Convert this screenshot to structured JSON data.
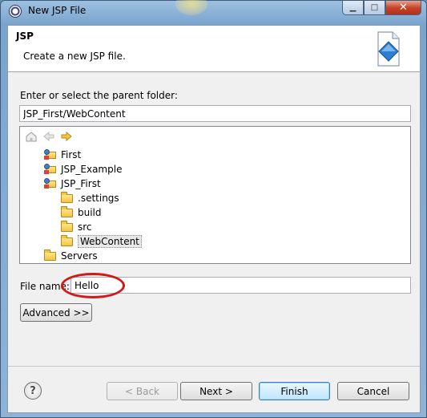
{
  "window": {
    "title": "New JSP File",
    "minimize_glyph": "▁",
    "maximize_glyph": "□",
    "close_glyph": "✕"
  },
  "header": {
    "title": "JSP",
    "description": "Create a new JSP file."
  },
  "parent_folder": {
    "label": "Enter or select the parent folder:",
    "value": "JSP_First/WebContent"
  },
  "tree": {
    "toolbar": [
      "home-icon",
      "back-icon",
      "forward-icon"
    ],
    "items": [
      {
        "label": "First",
        "type": "project"
      },
      {
        "label": "JSP_Example",
        "type": "project"
      },
      {
        "label": "JSP_First",
        "type": "project"
      },
      {
        "label": ".settings",
        "type": "folder"
      },
      {
        "label": "build",
        "type": "folder"
      },
      {
        "label": "src",
        "type": "folder"
      },
      {
        "label": "WebContent",
        "type": "folder",
        "selected": true
      },
      {
        "label": "Servers",
        "type": "folder"
      }
    ]
  },
  "file_name": {
    "label": "File name:",
    "value": "Hello"
  },
  "buttons": {
    "advanced": "Advanced >>",
    "back": "< Back",
    "next": "Next >",
    "finish": "Finish",
    "cancel": "Cancel",
    "help": "?"
  },
  "colors": {
    "annotation": "#d01a1a",
    "default_button_border": "#3c7fb1"
  }
}
